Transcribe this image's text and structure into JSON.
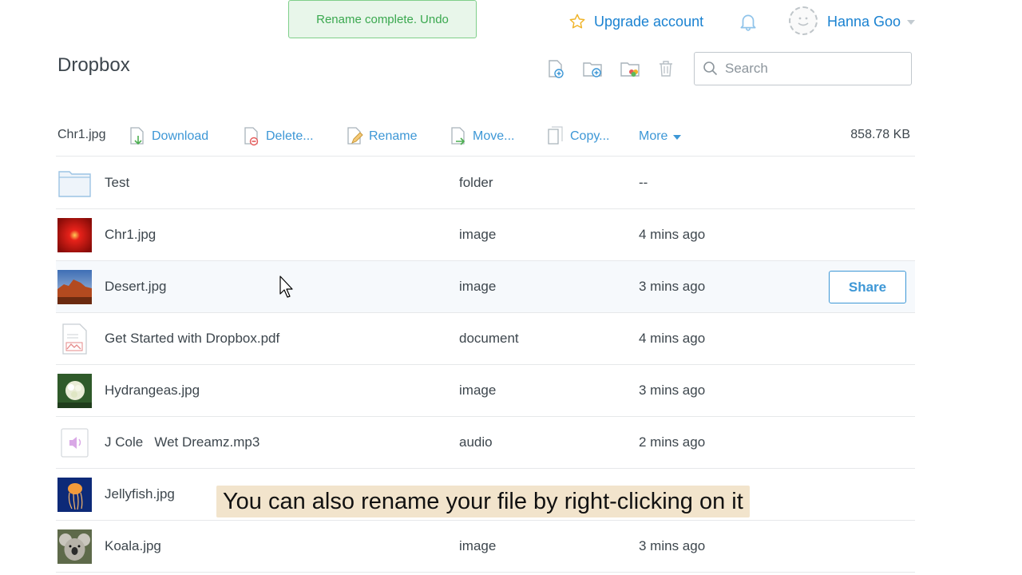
{
  "toast": {
    "message": "Rename complete.",
    "undo_label": "Undo"
  },
  "header": {
    "upgrade_label": "Upgrade account",
    "username": "Hanna Goo"
  },
  "page": {
    "title": "Dropbox"
  },
  "toolbar": {
    "icons": [
      "new-file-icon",
      "new-folder-icon",
      "shared-folder-icon",
      "trash-icon"
    ]
  },
  "search": {
    "placeholder": "Search",
    "value": ""
  },
  "action_bar": {
    "selected_file": "Chr1.jpg",
    "download": "Download",
    "delete": "Delete...",
    "rename": "Rename",
    "move": "Move...",
    "copy": "Copy...",
    "more": "More",
    "size": "858.78 KB"
  },
  "files": [
    {
      "name": "Test",
      "kind": "folder",
      "modified": "--",
      "icon": "folder-icon"
    },
    {
      "name": "Chr1.jpg",
      "kind": "image",
      "modified": "4 mins ago",
      "icon": "red-flower-thumbnail"
    },
    {
      "name": "Desert.jpg",
      "kind": "image",
      "modified": "3 mins ago",
      "icon": "desert-thumbnail",
      "share_label": "Share"
    },
    {
      "name": "Get Started with Dropbox.pdf",
      "kind": "document",
      "modified": "4 mins ago",
      "icon": "pdf-icon"
    },
    {
      "name": "Hydrangeas.jpg",
      "kind": "image",
      "modified": "3 mins ago",
      "icon": "hydrangeas-thumbnail"
    },
    {
      "name": "J Cole   Wet Dreamz.mp3",
      "kind": "audio",
      "modified": "2 mins ago",
      "icon": "audio-icon"
    },
    {
      "name": "Jellyfish.jpg",
      "kind": "",
      "modified": "",
      "icon": "jellyfish-thumbnail"
    },
    {
      "name": "Koala.jpg",
      "kind": "image",
      "modified": "3 mins ago",
      "icon": "koala-thumbnail"
    }
  ],
  "caption": "You can also rename your file by right-clicking on it",
  "colors": {
    "accent": "#3d97d6",
    "toast_green": "#3aa84f",
    "text": "#3d464d"
  }
}
